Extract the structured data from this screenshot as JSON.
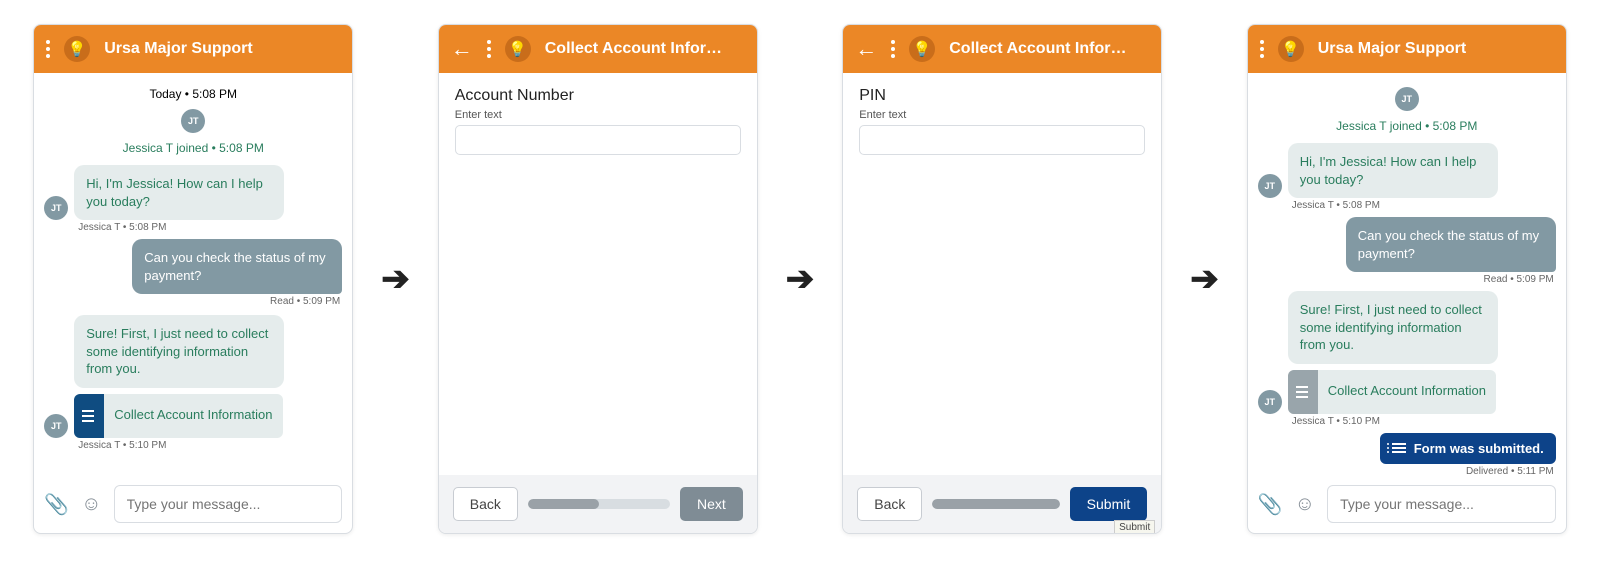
{
  "colors": {
    "brand": "#eb8726",
    "submit": "#0d4389"
  },
  "arrow_glyph": "➔",
  "avatar_initials": "JT",
  "compose_placeholder": "Type your message...",
  "panel1": {
    "title": "Ursa Major Support",
    "today_line": "Today • 5:08 PM",
    "joined_line": "Jessica T joined • 5:08 PM",
    "agent_greeting": "Hi, I'm Jessica! How can I help you today?",
    "agent_greeting_meta": "Jessica T • 5:08 PM",
    "user_msg": "Can you check the status of my payment?",
    "user_msg_meta": "Read • 5:09 PM",
    "agent_collect": "Sure! First, I just need to collect some identifying information from you.",
    "form_card_label": "Collect Account Information",
    "form_card_meta": "Jessica T • 5:10 PM"
  },
  "panel2": {
    "title": "Collect Account Infor…",
    "field_label": "Account Number",
    "hint": "Enter text",
    "back": "Back",
    "next": "Next",
    "progress_pct": 50
  },
  "panel3": {
    "title": "Collect Account Infor…",
    "field_label": "PIN",
    "hint": "Enter text",
    "back": "Back",
    "submit": "Submit",
    "tooltip": "Submit",
    "progress_pct": 100
  },
  "panel4": {
    "title": "Ursa Major Support",
    "joined_line": "Jessica T joined • 5:08 PM",
    "agent_greeting": "Hi, I'm Jessica! How can I help you today?",
    "agent_greeting_meta": "Jessica T • 5:08 PM",
    "user_msg": "Can you check the status of my payment?",
    "user_msg_meta": "Read • 5:09 PM",
    "agent_collect": "Sure! First, I just need to collect some identifying information from you.",
    "form_card_label": "Collect Account Information",
    "form_card_meta": "Jessica T • 5:10 PM",
    "form_submitted": "Form was submitted.",
    "form_submitted_meta": "Delivered • 5:11 PM"
  }
}
